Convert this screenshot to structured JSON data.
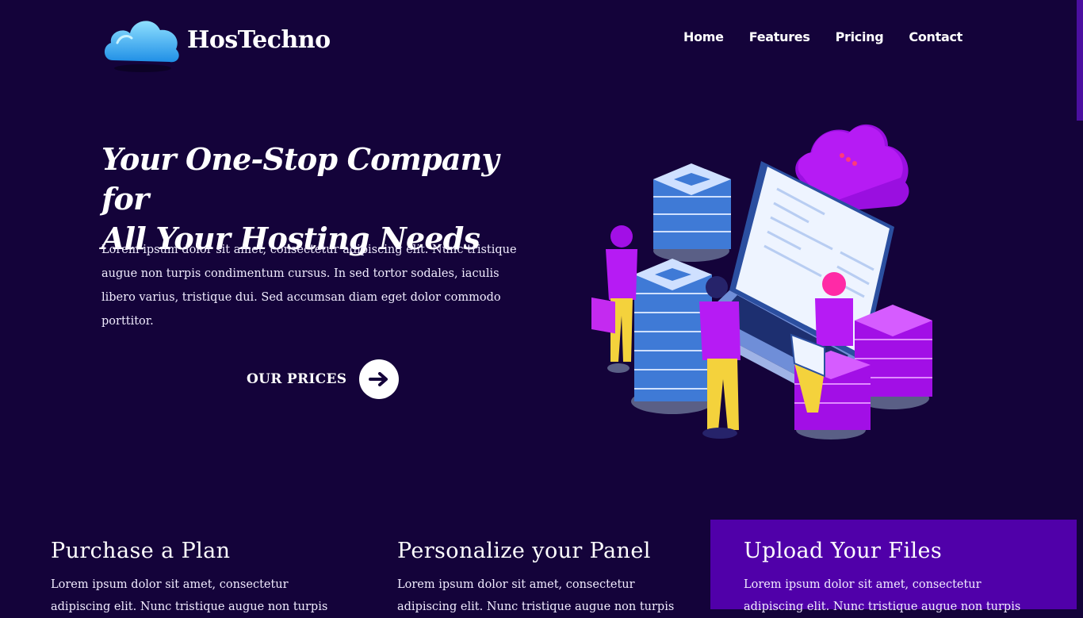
{
  "brand": {
    "name": "HosTechno"
  },
  "nav": {
    "items": [
      "Home",
      "Features",
      "Pricing",
      "Contact"
    ]
  },
  "hero": {
    "title_line1": "Your One-Stop Company for",
    "title_line2": "All Your Hosting Needs",
    "text": "Lorem ipsum dolor sit amet, consectetur adipiscing elit. Nunc tristique augue non turpis condimentum cursus. In sed tortor sodales, iaculis libero varius, tristique dui. Sed accumsan diam eget dolor commodo porttitor.",
    "cta_label": "OUR PRICES",
    "cta_icon": "arrow-right-icon"
  },
  "features": [
    {
      "title": "Purchase a Plan",
      "text": "Lorem ipsum dolor sit amet, consectetur adipiscing elit. Nunc tristique augue non turpis"
    },
    {
      "title": "Personalize your Panel",
      "text": "Lorem ipsum dolor sit amet, consectetur adipiscing elit. Nunc tristique augue non turpis"
    },
    {
      "title": "Upload Your Files",
      "text": "Lorem ipsum dolor sit amet, consectetur adipiscing elit. Nunc tristique augue non turpis"
    }
  ],
  "colors": {
    "background": "#14033a",
    "highlight_panel": "#5000a9",
    "accent_purple": "#a50fe6",
    "accent_blue": "#4f8fe0"
  }
}
